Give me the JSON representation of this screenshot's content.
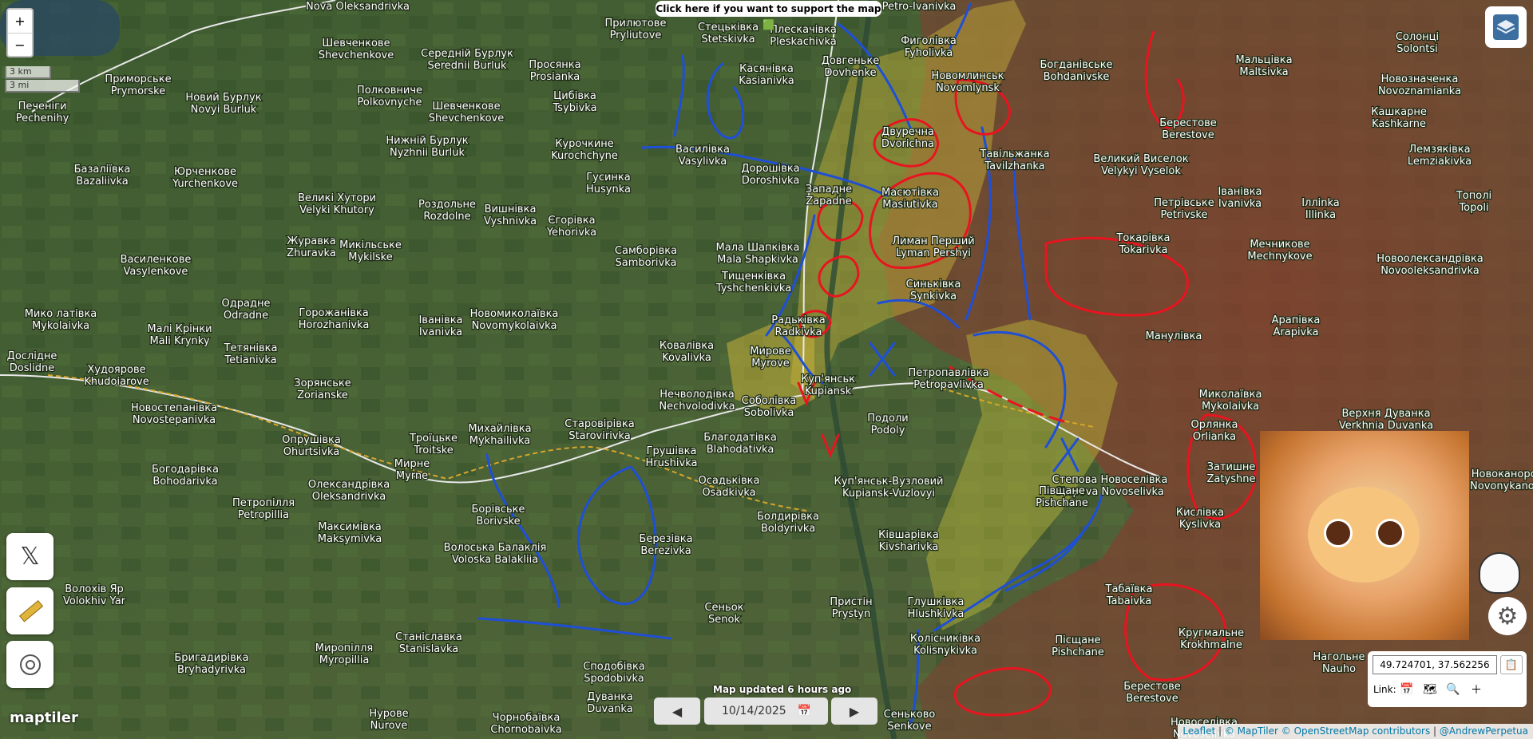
{
  "support_banner": "Click here if you want to support the map 🟩",
  "zoom": {
    "in": "+",
    "out": "−"
  },
  "scale": {
    "km": "3 km",
    "mi": "3 mi"
  },
  "updated": "Map updated 6 hours ago",
  "date_value": "10/14/2025",
  "coordinates": "49.724701, 37.562256",
  "link_label": "Link:",
  "attribution": {
    "leaflet": "Leaflet",
    "maptiler": "© MapTiler",
    "osm": "© OpenStreetMap contributors",
    "author": "@AndrewPerpetua"
  },
  "maptiler_logo": "maptiler",
  "places": [
    [
      "Новий Бурлук",
      "Novyi Burluk",
      280,
      126
    ],
    [
      "Приморське",
      "Prymorske",
      173,
      103
    ],
    [
      "Печеніги",
      "Pechenihy",
      53,
      137
    ],
    [
      "Nova Oleksandrivka",
      "",
      448,
      12
    ],
    [
      "Шевченкове",
      "Shevchenkove",
      446,
      58
    ],
    [
      "Середній Бурлук",
      "Serednii Burluk",
      585,
      71
    ],
    [
      "Просянка",
      "Prosianka",
      695,
      85
    ],
    [
      "Прилютове",
      "Pryliutove",
      796,
      33
    ],
    [
      "Стецьківка",
      "Stetskivka",
      912,
      38
    ],
    [
      "Плескачівка",
      "Pleskachivka",
      1006,
      41
    ],
    [
      "Фиголівка",
      "Fyholivka",
      1163,
      55
    ],
    [
      "Petro-Ivanivka",
      "",
      1151,
      12
    ],
    [
      "Полковниче",
      "Polkovnyche",
      488,
      117
    ],
    [
      "Шевченкове",
      "Shevchenkove",
      584,
      137
    ],
    [
      "Цибівка",
      "Tsybivka",
      720,
      124
    ],
    [
      "Касянівка",
      "Kasianivka",
      960,
      90
    ],
    [
      "Довгеньке",
      "Dovhenke",
      1065,
      80
    ],
    [
      "Новомлинськ",
      "Novomlynsk",
      1212,
      99
    ],
    [
      "Богданівське",
      "Bohdanivske",
      1348,
      85
    ],
    [
      "Мальцівка",
      "Maltsivka",
      1583,
      79
    ],
    [
      "Солонці",
      "Solontsi",
      1775,
      50
    ],
    [
      "Новозначенка",
      "Novoznamianka",
      1778,
      103
    ],
    [
      "Кашкарне",
      "Kashkarne",
      1752,
      144
    ],
    [
      "Нижній Бурлук",
      "Nyzhnii Burluk",
      535,
      180
    ],
    [
      "Курочкине",
      "Kurochchyne",
      732,
      184
    ],
    [
      "Василівка",
      "Vasylivka",
      880,
      191
    ],
    [
      "Двуречна",
      "Dvorichna",
      1137,
      169
    ],
    [
      "Тавільжанка",
      "Tavilzhanka",
      1271,
      197
    ],
    [
      "Великий Виселок",
      "Velykyi Vyselok",
      1429,
      203
    ],
    [
      "Берестове",
      "Berestove",
      1488,
      158
    ],
    [
      "Лемзяківка",
      "Lemziakivka",
      1803,
      191
    ],
    [
      "Базаліївка",
      "Bazaliivka",
      128,
      216
    ],
    [
      "Юрченкове",
      "Yurchenkove",
      257,
      219
    ],
    [
      "Великі Хутори",
      "Velyki Khutory",
      422,
      252
    ],
    [
      "Гусинка",
      "Husynka",
      762,
      226
    ],
    [
      "Дорошівка",
      "Doroshivka",
      965,
      215
    ],
    [
      "Западне",
      "Zapadne",
      1038,
      241
    ],
    [
      "Масютівка",
      "Masiutivka",
      1140,
      245
    ],
    [
      "Іванівка",
      "Ivanivka",
      1553,
      244
    ],
    [
      "Петрівське",
      "Petrivske",
      1483,
      258
    ],
    [
      "Ілліnka",
      "Illinka",
      1654,
      258
    ],
    [
      "Тополі",
      "Topoli",
      1846,
      249
    ],
    [
      "Роздольне",
      "Rozdolne",
      560,
      260
    ],
    [
      "Вишнівка",
      "Vyshnivka",
      639,
      266
    ],
    [
      "Єгорівка",
      "Yehorivka",
      716,
      280
    ],
    [
      "Журавка",
      "Zhuravka",
      390,
      306
    ],
    [
      "Микільське",
      "Mykilske",
      464,
      311
    ],
    [
      "Самборівка",
      "Samborivka",
      809,
      318
    ],
    [
      "Мала Шапківка",
      "Mala Shapkivka",
      949,
      314
    ],
    [
      "Лиман Перший",
      "Lyman Pershyi",
      1169,
      306
    ],
    [
      "Токарівка",
      "Tokarivka",
      1432,
      302
    ],
    [
      "Мечникове",
      "Mechnykove",
      1603,
      310
    ],
    [
      "Новоолександрівка",
      "Novooleksandrivka",
      1791,
      328
    ],
    [
      "Василенкове",
      "Vasylenkove",
      195,
      329
    ],
    [
      "Одрадне",
      "Odradne",
      308,
      384
    ],
    [
      "Тищенківка",
      "Tyshchenkivka",
      944,
      350
    ],
    [
      "Синьківка",
      "Synkivka",
      1169,
      360
    ],
    [
      "Мико латівка",
      "Mykolaivka",
      76,
      397
    ],
    [
      "Горожанівка",
      "Horozhanivka",
      418,
      396
    ],
    [
      "Іванівка",
      "Ivanivka",
      552,
      405
    ],
    [
      "Новомиколаївка",
      "Novomykolaivka",
      644,
      397
    ],
    [
      "Радьківка",
      "Radkivka",
      1000,
      405
    ],
    [
      "Манулівка",
      "",
      1470,
      425
    ],
    [
      "Арапівка",
      "Arapivka",
      1623,
      405
    ],
    [
      "Малі Крінки",
      "Mali Krynky",
      225,
      416
    ],
    [
      "Тетянівка",
      "Tetianivka",
      314,
      440
    ],
    [
      "Ковалівка",
      "Kovalivka",
      860,
      437
    ],
    [
      "Мирове",
      "Myrove",
      965,
      444
    ],
    [
      "Доcлідне",
      "Doslidne",
      40,
      450
    ],
    [
      "Худоярове",
      "Khudoiarove",
      146,
      467
    ],
    [
      "Зорянське",
      "Zorianske",
      404,
      484
    ],
    [
      "Нечволодівка",
      "Nechvolodivka",
      873,
      498
    ],
    [
      "Соболівка",
      "Sobolivka",
      963,
      506
    ],
    [
      "Куп'янськ",
      "Kupiansk",
      1037,
      479
    ],
    [
      "Петропавлівка",
      "Petropavlivka",
      1188,
      471
    ],
    [
      "Миколаївка",
      "Mykolaivka",
      1541,
      498
    ],
    [
      "Верхня Дуванка",
      "Verkhnia Duvanka",
      1736,
      522
    ],
    [
      "Новостепанівка",
      "Novostepanivka",
      218,
      515
    ],
    [
      "Старовірівка",
      "Starovirivka",
      751,
      535
    ],
    [
      "Подоли",
      "Podoly",
      1112,
      528
    ],
    [
      "Орлянка",
      "Orlianka",
      1521,
      536
    ],
    [
      "Опрушівка",
      "Ohurtsivka",
      390,
      555
    ],
    [
      "Троїцьке",
      "Troitske",
      543,
      553
    ],
    [
      "Михайлівка",
      "Mykhailivka",
      626,
      541
    ],
    [
      "Благодатівка",
      "Blahodativka",
      927,
      552
    ],
    [
      "Затишне",
      "Zatyshne",
      1542,
      589
    ],
    [
      "Новоканорське",
      "Novonykanorske",
      1895,
      598
    ],
    [
      "Богодарівка",
      "Bohodarivka",
      232,
      592
    ],
    [
      "Мирне",
      "Myrne",
      516,
      585
    ],
    [
      "Грушівка",
      "Hrushivka",
      841,
      569
    ],
    [
      "Осадьківка",
      "Osadkivka",
      913,
      606
    ],
    [
      "Куп'янськ-Вузловий",
      "Kupiansk-Vuzlovyi",
      1113,
      607
    ],
    [
      "Степова Новоселівка",
      "Stepova Novoselivka",
      1390,
      605
    ],
    [
      "Петропілля",
      "Petropillia",
      330,
      634
    ],
    [
      "Олександрівка",
      "Oleksandrivka",
      437,
      611
    ],
    [
      "Півщане",
      "Pishchane",
      1330,
      619
    ],
    [
      "Кислівка",
      "Kyslivka",
      1503,
      646
    ],
    [
      "Борівське",
      "Borivske",
      624,
      642
    ],
    [
      "Болдирівка",
      "Boldyrivka",
      987,
      651
    ],
    [
      "Максимівка",
      "Maksymivka",
      438,
      664
    ],
    [
      "Березівка",
      "Berezivka",
      834,
      679
    ],
    [
      "Ківшарівка",
      "Kivsharivka",
      1138,
      674
    ],
    [
      "Волоська Балаклія",
      "Voloska Balakliia",
      620,
      690
    ],
    [
      "Волохів Яр",
      "Volokhiv Yar",
      118,
      742
    ],
    [
      "Сеньок",
      "Senok",
      907,
      765
    ],
    [
      "Пристін",
      "Prystyn",
      1066,
      758
    ],
    [
      "Глушківка",
      "Hlushkivka",
      1172,
      758
    ],
    [
      "Табаївка",
      "Tabaivka",
      1414,
      742
    ],
    [
      "Кругмальне",
      "Krokhmalne",
      1517,
      797
    ],
    [
      "Пісщане",
      "Pishchane",
      1350,
      806
    ],
    [
      "Колісниківка",
      "Kolisnykivka",
      1184,
      804
    ],
    [
      "Станіславка",
      "Stanislavka",
      537,
      802
    ],
    [
      "Миропілля",
      "Myropillia",
      431,
      816
    ],
    [
      "Бригадирівка",
      "Bryhadyrivka",
      265,
      828
    ],
    [
      "Сподобівка",
      "Spodobivka",
      769,
      839
    ],
    [
      "Дуванка",
      "Duvanka",
      764,
      877
    ],
    [
      "Нагольне",
      "Nauho",
      1677,
      827
    ],
    [
      "Чорнобаївка",
      "Chornobaivka",
      659,
      903
    ],
    [
      "Нурове",
      "Nurove",
      487,
      898
    ],
    [
      "Берестове",
      "Berestove",
      1443,
      864
    ],
    [
      "Сеньково",
      "Senkove",
      1139,
      899
    ],
    [
      "Новоселівка",
      "Novoselivka",
      1508,
      909
    ]
  ],
  "colors": {
    "ua_blue": "#1f4fd6",
    "ru_red": "#e8141f",
    "grey_zone": "#c8c43a",
    "occupied": "#9a3b2e"
  },
  "icons": [
    "x-icon",
    "ruler-icon",
    "location-icon",
    "layers-icon",
    "settings-icon",
    "calendar-icon",
    "copy-icon"
  ]
}
